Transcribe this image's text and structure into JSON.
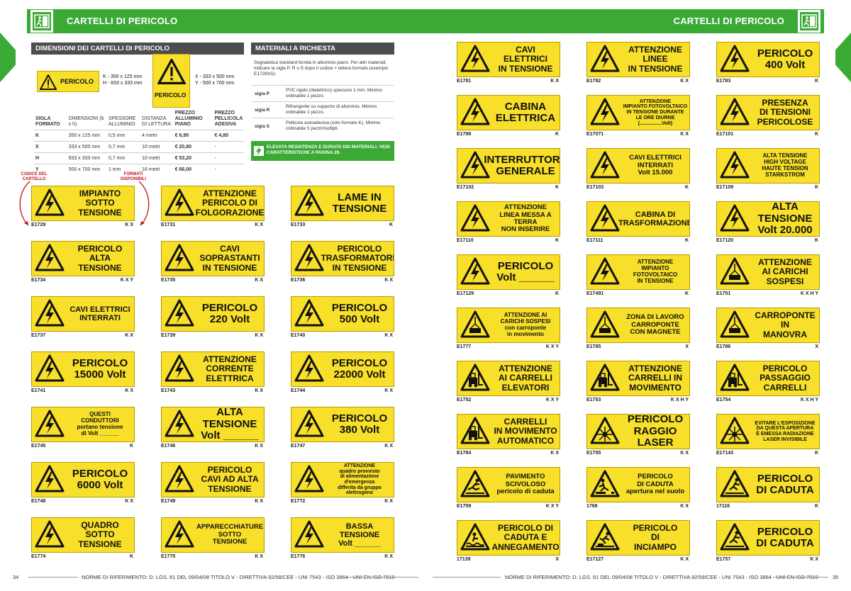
{
  "header": {
    "left_title": "CARTELLI DI PERICOLO",
    "right_title": "CARTELLI DI PERICOLO"
  },
  "dimensions": {
    "title": "DIMENSIONI DEI CARTELLI DI PERICOLO",
    "sample_text": "PERICOLO",
    "small_k": "K - 350 x 125 mm",
    "small_h": "H - 833 x 333 mm",
    "big_x": "X - 333 x 500 mm",
    "big_y": "Y - 500 x 700 mm",
    "headers": [
      "SIGLA FORMATO",
      "DIMENSIONI (b x h)",
      "SPESSORE ALLUMINIO",
      "DISTANZA DI LETTURA",
      "PREZZO ALLUMINIO PIANO",
      "PREZZO PELLICOLA ADESIVA"
    ],
    "rows": [
      [
        "K",
        "350 x 125 mm",
        "0,5 mm",
        "4 metri",
        "€ 6,90",
        "€ 4,80"
      ],
      [
        "X",
        "333 x 500 mm",
        "0,7 mm",
        "10 metri",
        "€ 20,80",
        "-"
      ],
      [
        "H",
        "833 x 333 mm",
        "0,7 mm",
        "10 metri",
        "€ 53,20",
        "-"
      ],
      [
        "Y",
        "500 x 700 mm",
        "1 mm",
        "16 metri",
        "€ 66,00",
        "-"
      ]
    ]
  },
  "materials": {
    "title": "MATERIALI A RICHIESTA",
    "intro": "Segnaletica standard fornita in alluminio piano. Per altri materiali, indicare la sigla P, R o S dopo il codice + lettera formato (esempio E1729XS):",
    "rows": [
      {
        "key": "sigla P",
        "text": "PVC rigido (dielettrico) spessore 1 mm. Minimo ordinabile 1 pezzo."
      },
      {
        "key": "sigla R",
        "text": "Rifrangente su supporto di alluminio. Minimo ordinabile 1 pezzo."
      },
      {
        "key": "sigla S",
        "text": "Pellicola autoadesiva (solo formato K). Minimo ordinabile 5 pezzi/multipli."
      }
    ],
    "notice": "ELEVATA RESISTENZA E DURATA DEI MATERIALI. VEDI CARATTERISTICHE A PAGINA 26."
  },
  "annotations": {
    "code_label": "CODICE DEL CARTELLO",
    "formats_label": "FORMATI DISPONIBILI"
  },
  "signs": [
    {
      "code": "E1729",
      "formats": "K X",
      "text": "IMPIANTO\nSOTTO\nTENSIONE",
      "icon": "lightning-icon"
    },
    {
      "code": "E1731",
      "formats": "K X",
      "text": "ATTENZIONE\nPERICOLO DI\nFOLGORAZIONE",
      "icon": "lightning-icon"
    },
    {
      "code": "E1733",
      "formats": "K",
      "text": "LAME IN\nTENSIONE",
      "icon": "lightning-icon"
    },
    {
      "code": "E1734",
      "formats": "K X Y",
      "text": "PERICOLO\nALTA\nTENSIONE",
      "icon": "lightning-icon"
    },
    {
      "code": "E1735",
      "formats": "K X",
      "text": "CAVI\nSOPRASTANTI\nIN TENSIONE",
      "icon": "lightning-icon"
    },
    {
      "code": "E1736",
      "formats": "K X",
      "text": "PERICOLO\nTRASFORMATORE\nIN TENSIONE",
      "icon": "lightning-icon"
    },
    {
      "code": "E1737",
      "formats": "K X",
      "text": "CAVI ELETTRICI\nINTERRATI",
      "icon": "lightning-icon"
    },
    {
      "code": "E1739",
      "formats": "K X",
      "text": "PERICOLO\n220 Volt",
      "icon": "lightning-icon"
    },
    {
      "code": "E1740",
      "formats": "K X",
      "text": "PERICOLO\n500 Volt",
      "icon": "lightning-icon"
    },
    {
      "code": "E1741",
      "formats": "K X",
      "text": "PERICOLO\n15000 Volt",
      "icon": "lightning-icon"
    },
    {
      "code": "E1743",
      "formats": "K X",
      "text": "ATTENZIONE\nCORRENTE\nELETTRICA",
      "icon": "lightning-icon"
    },
    {
      "code": "E1744",
      "formats": "K X",
      "text": "PERICOLO\n22000 Volt",
      "icon": "lightning-icon"
    },
    {
      "code": "E1745",
      "formats": "K",
      "text": "QUESTI\nCONDUTTORI\nportano tensione\ndi Volt ______",
      "icon": "lightning-icon"
    },
    {
      "code": "E1746",
      "formats": "K X",
      "text": "ALTA TENSIONE\nVolt ______",
      "icon": "lightning-icon"
    },
    {
      "code": "E1747",
      "formats": "K X",
      "text": "PERICOLO\n380 Volt",
      "icon": "lightning-icon"
    },
    {
      "code": "E1748",
      "formats": "K X",
      "text": "PERICOLO\n6000 Volt",
      "icon": "lightning-icon"
    },
    {
      "code": "E1749",
      "formats": "K X",
      "text": "PERICOLO\nCAVI AD ALTA\nTENSIONE",
      "icon": "lightning-icon"
    },
    {
      "code": "E1772",
      "formats": "K X",
      "text": "ATTENZIONE\nquadro provvisto\ndi alimentazione d'emergenza\ndifferita da gruppo elettrogeno",
      "icon": "lightning-icon"
    },
    {
      "code": "E1774",
      "formats": "K",
      "text": "QUADRO\nSOTTO\nTENSIONE",
      "icon": "lightning-icon"
    },
    {
      "code": "E1775",
      "formats": "K X",
      "text": "APPARECCHIATURE\nSOTTO\nTENSIONE",
      "icon": "lightning-icon"
    },
    {
      "code": "E1776",
      "formats": "K X",
      "text": "BASSA TENSIONE\nVolt ______",
      "icon": "lightning-icon"
    },
    {
      "code": "E1781",
      "formats": "K X",
      "text": "CAVI\nELETTRICI\nIN TENSIONE",
      "icon": "lightning-icon"
    },
    {
      "code": "E1782",
      "formats": "K X",
      "text": "ATTENZIONE\nLINEE\nIN TENSIONE",
      "icon": "lightning-icon"
    },
    {
      "code": "E1783",
      "formats": "K",
      "text": "PERICOLO\n400 Volt",
      "icon": "lightning-icon"
    },
    {
      "code": "E1798",
      "formats": "K",
      "text": "CABINA\nELETTRICA",
      "icon": "lightning-icon"
    },
    {
      "code": "E17071",
      "formats": "K X",
      "text": "ATTENZIONE\nIMPIANTO FOTOVOLTAICO\nIN TENSIONE DURANTE\nLE ORE DIURNE\n(................Volt)",
      "icon": "lightning-icon"
    },
    {
      "code": "E17101",
      "formats": "K",
      "text": "PRESENZA\nDI TENSIONI\nPERICOLOSE",
      "icon": "lightning-icon"
    },
    {
      "code": "E17102",
      "formats": "K",
      "text": "INTERRUTTORE\nGENERALE",
      "icon": "lightning-icon"
    },
    {
      "code": "E17103",
      "formats": "K",
      "text": "CAVI ELETTRICI\nINTERRATI\nVolt 15.000",
      "icon": "lightning-icon"
    },
    {
      "code": "E17109",
      "formats": "K",
      "text": "ALTA TENSIONE\nHIGH VOLTAGE\nHAUTE TENSION\nSTARKSTROM",
      "icon": "lightning-icon"
    },
    {
      "code": "E17110",
      "formats": "K",
      "text": "ATTENZIONE\nLINEA MESSA A TERRA\nNON INSERIRE",
      "icon": "lightning-icon"
    },
    {
      "code": "E17111",
      "formats": "K",
      "text": "CABINA DI\nTRASFORMAZIONE",
      "icon": "lightning-icon"
    },
    {
      "code": "E17120",
      "formats": "K",
      "text": "ALTA TENSIONE\nVolt 20.000",
      "icon": "lightning-icon"
    },
    {
      "code": "E17129",
      "formats": "K",
      "text": "PERICOLO\nVolt ______",
      "icon": "lightning-icon"
    },
    {
      "code": "E17491",
      "formats": "K",
      "text": "ATTENZIONE\nIMPIANTO\nFOTOVOLTAICO\nIN TENSIONE",
      "icon": "lightning-icon"
    },
    {
      "code": "E1751",
      "formats": "K X H Y",
      "text": "ATTENZIONE\nAI CARICHI\nSOSPESI",
      "icon": "suspended-load-icon"
    },
    {
      "code": "E1777",
      "formats": "K X Y",
      "text": "ATTENZIONE AI\nCARICHI SOSPESI\ncon carroponte\nin movimento",
      "icon": "suspended-load-icon"
    },
    {
      "code": "E1785",
      "formats": "X",
      "text": "ZONA DI LAVORO\nCARROPONTE\nCON MAGNETE",
      "icon": "suspended-load-icon"
    },
    {
      "code": "E1786",
      "formats": "X",
      "text": "CARROPONTE\nIN\nMANOVRA",
      "icon": "suspended-load-icon"
    },
    {
      "code": "E1752",
      "formats": "K X Y",
      "text": "ATTENZIONE\nAI CARRELLI\nELEVATORI",
      "icon": "forklift-icon"
    },
    {
      "code": "E1753",
      "formats": "K X H Y",
      "text": "ATTENZIONE\nCARRELLI IN\nMOVIMENTO",
      "icon": "forklift-icon"
    },
    {
      "code": "E1754",
      "formats": "K X H Y",
      "text": "PERICOLO\nPASSAGGIO\nCARRELLI",
      "icon": "forklift-icon"
    },
    {
      "code": "E1784",
      "formats": "K X",
      "text": "CARRELLI\nIN MOVIMENTO\nAUTOMATICO",
      "icon": "forklift-icon"
    },
    {
      "code": "E1755",
      "formats": "K X",
      "text": "PERICOLO\nRAGGIO LASER",
      "icon": "laser-icon"
    },
    {
      "code": "E17143",
      "formats": "K",
      "text": "EVITARE L'ESPOSIZIONE\nDA QUESTA APERTURA\nÈ EMESSA RADIAZIONE\nLASER INVISIBILE",
      "icon": "laser-icon"
    },
    {
      "code": "E1759",
      "formats": "K X Y",
      "text": "PAVIMENTO\nSCIVOLOSO\npericolo di caduta",
      "icon": "slip-icon"
    },
    {
      "code": "1768",
      "formats": "K X",
      "text": "PERICOLO\nDI CADUTA\napertura nel suolo",
      "icon": "fall-hole-icon"
    },
    {
      "code": "17116",
      "formats": "K",
      "text": "PERICOLO\nDI CADUTA",
      "icon": "fall-icon"
    },
    {
      "code": "17139",
      "formats": "X",
      "text": "PERICOLO DI\nCADUTA E\nANNEGAMENTO",
      "icon": "drowning-icon"
    },
    {
      "code": "E17127",
      "formats": "K X",
      "text": "PERICOLO\nDI\nINCIAMPO",
      "icon": "trip-icon"
    },
    {
      "code": "E1757",
      "formats": "K X",
      "text": "PERICOLO\nDI CADUTA",
      "icon": "fall-icon"
    }
  ],
  "footer": {
    "page_left": "34",
    "page_right": "35",
    "note": "NORME DI RIFERIMENTO: D. LGS. 81 DEL 09/04/08 TITOLO V - DIRETTIVA 92/58/CEE - UNI 7543 - ISO 3864 - UNI EN ISO 7010"
  }
}
